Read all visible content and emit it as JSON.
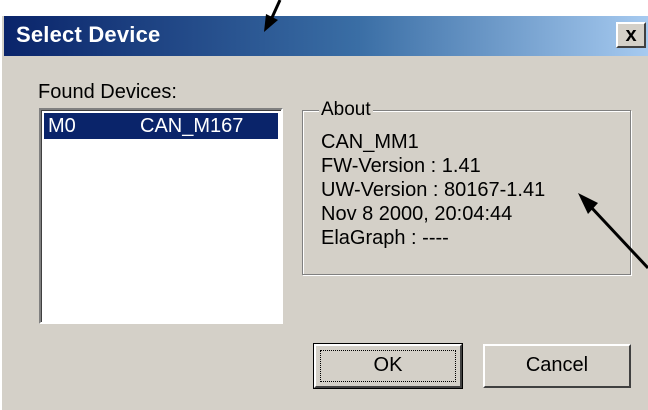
{
  "window": {
    "title": "Select Device",
    "close_glyph": "x"
  },
  "found_devices": {
    "label": "Found Devices:",
    "items": [
      {
        "id": "M0",
        "name": "CAN_M167"
      }
    ]
  },
  "about": {
    "legend": "About",
    "lines": [
      "CAN_MM1",
      "FW-Version : 1.41",
      "UW-Version : 80167-1.41",
      "Nov  8 2000, 20:04:44",
      "ElaGraph : ----"
    ]
  },
  "buttons": {
    "ok": "OK",
    "cancel": "Cancel"
  },
  "colors": {
    "title_gradient_start": "#0a246a",
    "title_gradient_end": "#a6caf0",
    "selection": "#0a246a",
    "face": "#d4d0c8"
  }
}
